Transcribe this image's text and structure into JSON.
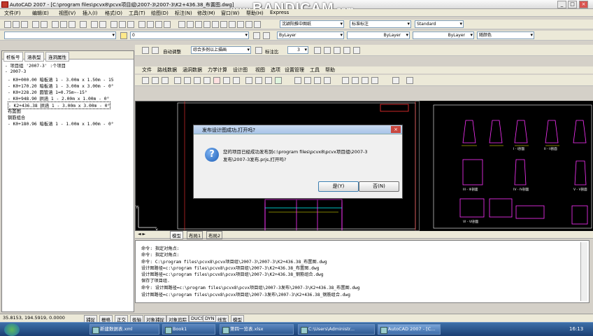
{
  "window": {
    "title": "AutoCAD 2007 - [C:\\program files\\pcvx8\\pcvx项目组\\2007-3\\2007-3\\K2+436.38_布置图.dwg]",
    "min": "_",
    "max": "□",
    "close": "×"
  },
  "watermark": {
    "prefix": "www.",
    "brand": "BANDICAM",
    "suffix": ".com"
  },
  "menu": [
    "文件(F)",
    "编辑(E)",
    "视图(V)",
    "插入(I)",
    "格式(O)",
    "工具(T)",
    "绘图(D)",
    "标注(N)",
    "修改(M)",
    "窗口(W)",
    "帮助(H)",
    "Express"
  ],
  "toolbar": {
    "layer_value": "0",
    "text_style": "Standard",
    "dim_style1": "沈颖阳推中图纸",
    "dim_style2": "标准标注",
    "color": "ByLayer",
    "linetype": "ByLayer",
    "lineweight": "ByLayer",
    "plotstyle": "随颜色"
  },
  "pcvx": {
    "adjust_label": "自动调整",
    "adjust_value": "综合多例以上描画",
    "scale_label": "标注比",
    "scale_value": "3",
    "menu": [
      "文件",
      "路线数据",
      "涵洞数据",
      "力学计算",
      "设计图",
      "视图",
      "选项",
      "设置管理",
      "工具",
      "帮助"
    ]
  },
  "left_panel": {
    "tabs": [
      "桩板号",
      "涵表型",
      "连洞属性"
    ],
    "tree": [
      "- 项目组 '2007-3' :个项目",
      "- 2007-3",
      "  - K0+000.00 暗板涵 1 - 3.00m x 1.50m - 15",
      "  - K0+170.20 暗板涵 1 - 3.00m x 3.00m - 0°",
      "  - K0+228.20 圆管涵 1=0.75m~-15°",
      "  - K0+948.90 拱涵 1 - 2.00m x 1.00m - 0°",
      "  - K2+436.38 拱涵 1 - 3.00m x 3.00m - 0°",
      "      布置图",
      "      钢筋组合",
      "  - K0+180.96 暗板涵 1 - 1.00m x 1.00m - 0°"
    ]
  },
  "drawing": {
    "layout_tabs": [
      "模型",
      "布局1",
      "布局2"
    ],
    "section_labels": [
      "I - I剖面",
      "II - II剖面",
      "III - III剖面",
      "IV - IV剖面",
      "V - V剖面",
      "VI - VI剖面"
    ]
  },
  "command_history": [
    "命令: 指定对角点:",
    "命令: 指定对角点:",
    "命令:   C:\\program files\\pcvx8\\pcvx项目组\\2007-3\\2007-3\\K2+436.38_布置图.dwg",
    "设计图路径=c:\\program files\\pcvx8\\pcvx项目组\\2007-3\\K2+436.38_布置图.dwg",
    "设计图路径=c:\\program files\\pcvx8\\pcvx项目组\\2007-3\\K2+436.38_钢筋组合.dwg",
    "保存了项目组.",
    "命令: 设计图路径=c:\\program files\\pcvx8\\pcvx项目组\\2007-3发布\\2007-3\\K2+436.38_布置图.dwg",
    "设计图路径=c:\\program files\\pcvx8\\pcvx项目组\\2007-3发布\\2007-3\\K2+436.38_钢筋组合.dwg"
  ],
  "status_bar": {
    "coords": "35.8153, 194.5919, 0.0000",
    "buttons": [
      "捕捉",
      "栅格",
      "正交",
      "极轴",
      "对象捕捉",
      "对象追踪",
      "DUCS",
      "DYN",
      "线宽",
      "模型"
    ]
  },
  "dialog": {
    "title": "发布设计图成功,打开吗?",
    "message_line1": "您的项目已经成功发布到c:\\program files\\pcvx8\\pcvx项目组\\2007-3",
    "message_line2": "发布\\2007-3发布.prjs,打开吗?",
    "yes": "是(Y)",
    "no": "否(N)",
    "close": "×"
  },
  "taskbar": {
    "start": "",
    "tasks": [
      "新建数据表.xml",
      "Book1",
      "第四一览表.xlsx",
      "C:\\Users\\Administr...",
      "AutoCAD 2007 - [C..."
    ],
    "clock": "16:13"
  }
}
